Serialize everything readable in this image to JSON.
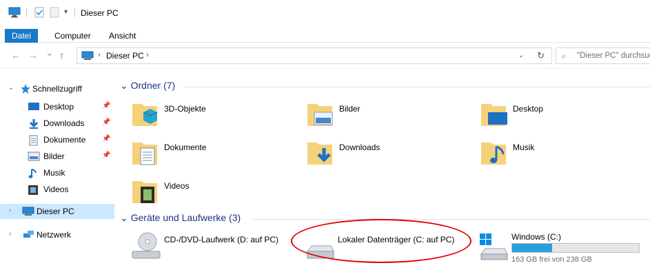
{
  "window": {
    "title": "Dieser PC"
  },
  "ribbon": {
    "tabs": [
      {
        "label": "Datei",
        "active": true
      },
      {
        "label": "Computer"
      },
      {
        "label": "Ansicht"
      }
    ]
  },
  "navbar": {
    "back": "←",
    "forward": "→",
    "recent": "⌄",
    "up": "↑",
    "breadcrumb": "Dieser PC",
    "search_placeholder": "\"Dieser PC\" durchsuchen"
  },
  "sidebar": {
    "quick_access": "Schnellzugriff",
    "items": [
      {
        "label": "Desktop",
        "icon": "desktop-icon",
        "pinned": true
      },
      {
        "label": "Downloads",
        "icon": "downloads-icon",
        "pinned": true
      },
      {
        "label": "Dokumente",
        "icon": "documents-icon",
        "pinned": true
      },
      {
        "label": "Bilder",
        "icon": "pictures-icon",
        "pinned": true
      },
      {
        "label": "Musik",
        "icon": "music-icon",
        "pinned": false
      },
      {
        "label": "Videos",
        "icon": "videos-icon",
        "pinned": false
      }
    ],
    "this_pc": "Dieser PC",
    "network": "Netzwerk"
  },
  "main": {
    "folders_header": "Ordner (7)",
    "folders": [
      {
        "label": "3D-Objekte",
        "icon": "3d-objects-icon"
      },
      {
        "label": "Bilder",
        "icon": "pictures-folder-icon"
      },
      {
        "label": "Desktop",
        "icon": "desktop-folder-icon"
      },
      {
        "label": "Dokumente",
        "icon": "documents-folder-icon"
      },
      {
        "label": "Downloads",
        "icon": "downloads-folder-icon"
      },
      {
        "label": "Musik",
        "icon": "music-folder-icon"
      },
      {
        "label": "Videos",
        "icon": "videos-folder-icon"
      }
    ],
    "drives_header": "Geräte und Laufwerke (3)",
    "drives": [
      {
        "label": "CD-/DVD-Laufwerk (D: auf PC)",
        "icon": "dvd-drive-icon"
      },
      {
        "label": "Lokaler Datenträger (C: auf PC)",
        "icon": "hard-drive-icon"
      },
      {
        "label": "Windows (C:)",
        "icon": "windows-drive-icon",
        "free_text": "163 GB frei von 238 GB",
        "used_fraction": 0.315
      }
    ]
  },
  "colors": {
    "accent": "#1979ca",
    "group_header": "#1e3287",
    "selection": "#cce8ff",
    "highlight": "#e30000",
    "usage_fill": "#26a0da"
  }
}
